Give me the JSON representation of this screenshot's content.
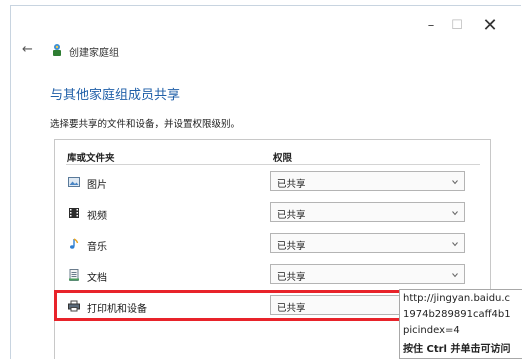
{
  "window": {
    "minimize_glyph": "–",
    "maximize_glyph": "☐",
    "close_glyph": "✕",
    "back_glyph": "←",
    "header_title": "创建家庭组"
  },
  "main": {
    "title": "与其他家庭组成员共享",
    "instruction": "选择要共享的文件和设备，并设置权限级别。",
    "columns": {
      "library": "库或文件夹",
      "permission": "权限"
    },
    "items": [
      {
        "label": "图片",
        "value": "已共享",
        "icon": "pictures-icon"
      },
      {
        "label": "视频",
        "value": "已共享",
        "icon": "videos-icon"
      },
      {
        "label": "音乐",
        "value": "已共享",
        "icon": "music-icon"
      },
      {
        "label": "文档",
        "value": "已共享",
        "icon": "documents-icon"
      },
      {
        "label": "打印机和设备",
        "value": "已共享",
        "icon": "printer-icon"
      }
    ]
  },
  "tooltip": {
    "lines": [
      "http://jingyan.baidu.c",
      "1974b289891caff4b1",
      "picindex=4",
      "按住 Ctrl 并单击可访问"
    ]
  },
  "colors": {
    "accent_title": "#1f5fa8",
    "highlight": "#e8232a"
  }
}
